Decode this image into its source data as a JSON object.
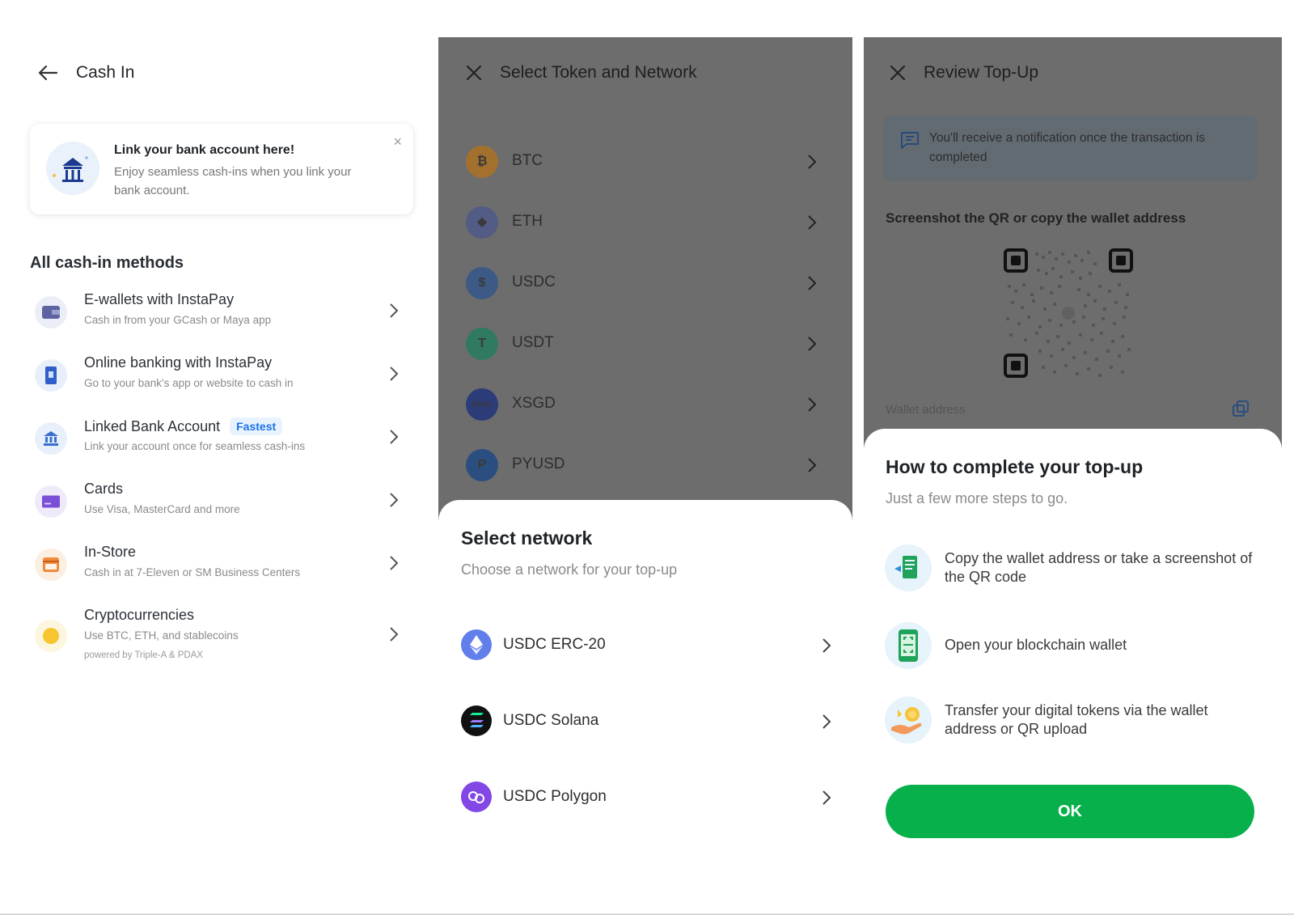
{
  "panel1": {
    "header": {
      "title": "Cash In"
    },
    "banner": {
      "title": "Link your bank account here!",
      "text": "Enjoy seamless cash-ins when you link your bank account.",
      "close": "×"
    },
    "section_title": "All cash-in methods",
    "methods": [
      {
        "title": "E-wallets with InstaPay",
        "subtitle": "Cash in from your GCash or Maya app",
        "icon": "wallet-icon"
      },
      {
        "title": "Online banking with InstaPay",
        "subtitle": "Go to your bank's app or website to cash in",
        "icon": "phone-bank-icon"
      },
      {
        "title": "Linked Bank Account",
        "badge": "Fastest",
        "subtitle": "Link your account once for seamless cash-ins",
        "icon": "bank-icon"
      },
      {
        "title": "Cards",
        "subtitle": "Use Visa, MasterCard and more",
        "icon": "card-icon"
      },
      {
        "title": "In-Store",
        "subtitle": "Cash in at 7-Eleven or SM Business Centers",
        "icon": "store-icon"
      },
      {
        "title": "Cryptocurrencies",
        "subtitle": "Use BTC, ETH, and stablecoins",
        "note": "powered by Triple-A & PDAX",
        "icon": "coin-icon"
      }
    ]
  },
  "panel2": {
    "header": {
      "title": "Select Token and Network"
    },
    "tokens": [
      {
        "label": "BTC",
        "glyph": "₿",
        "color": "#a4702d"
      },
      {
        "label": "ETH",
        "glyph": "◆",
        "color": "#525c84"
      },
      {
        "label": "USDC",
        "glyph": "$",
        "color": "#3c5a85"
      },
      {
        "label": "USDT",
        "glyph": "T",
        "color": "#2f7a61"
      },
      {
        "label": "XSGD",
        "glyph": "XSGD",
        "color": "#2c3c78"
      },
      {
        "label": "PYUSD",
        "glyph": "P",
        "color": "#2b4e80"
      }
    ],
    "sheet": {
      "title": "Select network",
      "subtitle": "Choose a network for your top-up",
      "networks": [
        {
          "label": "USDC ERC-20",
          "icon": "ethereum-icon",
          "color": "#627eea"
        },
        {
          "label": "USDC Solana",
          "icon": "solana-icon",
          "color": "#111111"
        },
        {
          "label": "USDC Polygon",
          "icon": "polygon-icon",
          "color": "#8247e5"
        }
      ]
    }
  },
  "panel3": {
    "header": {
      "title": "Review Top-Up"
    },
    "notice": "You'll receive a notification once the transaction is completed",
    "qr_label": "Screenshot the QR or copy the wallet address",
    "wallet_label": "Wallet address",
    "sheet": {
      "title": "How to complete your top-up",
      "subtitle": "Just a few more steps to go.",
      "steps": [
        {
          "text": "Copy the wallet address or take a screenshot of the QR code",
          "icon": "receipt-icon"
        },
        {
          "text": "Open your blockchain wallet",
          "icon": "phone-scan-icon"
        },
        {
          "text": "Transfer your digital tokens via the wallet address or QR upload",
          "icon": "hand-coins-icon"
        }
      ],
      "ok_label": "OK"
    }
  },
  "colors": {
    "accent_green": "#08b04b",
    "badge_blue": "#1a73e8",
    "overlay": "#6d6d6d"
  }
}
